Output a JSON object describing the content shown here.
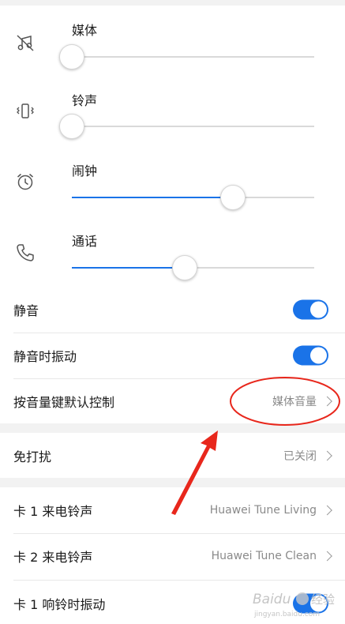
{
  "volumes": [
    {
      "label": "媒体",
      "icon": "music-off-icon",
      "level": 0.0
    },
    {
      "label": "铃声",
      "icon": "vibrate-icon",
      "level": 0.0
    },
    {
      "label": "闹钟",
      "icon": "alarm-clock-icon",
      "level": 0.666
    },
    {
      "label": "通话",
      "icon": "phone-icon",
      "level": 0.465
    }
  ],
  "toggles": [
    {
      "label": "静音",
      "on": true
    },
    {
      "label": "静音时振动",
      "on": true
    }
  ],
  "volume_key_default": {
    "label": "按音量键默认控制",
    "value": "媒体音量"
  },
  "dnd": {
    "label": "免打扰",
    "value": "已关闭"
  },
  "sim": [
    {
      "label": "卡 1 来电铃声",
      "value": "Huawei Tune Living"
    },
    {
      "label": "卡 2 来电铃声",
      "value": "Huawei Tune Clean"
    },
    {
      "label": "卡 1 响铃时振动",
      "on": true
    }
  ],
  "watermark": {
    "text": "Baidu 经验",
    "sub": "jingyan.baidu.com"
  },
  "colors": {
    "accent": "#1a73e8",
    "annotation": "#e8271c"
  }
}
